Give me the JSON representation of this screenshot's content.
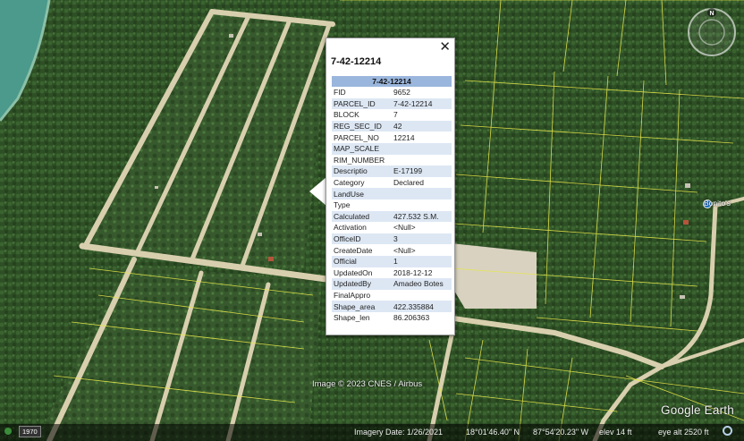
{
  "popup": {
    "title": "7-42-12214",
    "table_header": "7-42-12214",
    "close_symbol": "✕",
    "rows": [
      {
        "key": "FID",
        "value": "9652"
      },
      {
        "key": "PARCEL_ID",
        "value": "7-42-12214"
      },
      {
        "key": "BLOCK",
        "value": "7"
      },
      {
        "key": "REG_SEC_ID",
        "value": "42"
      },
      {
        "key": "PARCEL_NO",
        "value": "12214"
      },
      {
        "key": "MAP_SCALE",
        "value": ""
      },
      {
        "key": "RIM_NUMBER",
        "value": ""
      },
      {
        "key": "Descriptio",
        "value": "E-17199"
      },
      {
        "key": "Category",
        "value": "Declared"
      },
      {
        "key": "LandUse",
        "value": ""
      },
      {
        "key": "Type",
        "value": ""
      },
      {
        "key": "Calculated",
        "value": "427.532 S.M."
      },
      {
        "key": "Activation",
        "value": "<Null>"
      },
      {
        "key": "OfficeID",
        "value": "3"
      },
      {
        "key": "CreateDate",
        "value": "<Null>"
      },
      {
        "key": "Official",
        "value": "1"
      },
      {
        "key": "UpdatedOn",
        "value": "2018-12-12"
      },
      {
        "key": "UpdatedBy",
        "value": "Amadeo Botes"
      },
      {
        "key": "FinalAppro",
        "value": ""
      },
      {
        "key": "Shape_area",
        "value": "422.335884"
      },
      {
        "key": "Shape_len",
        "value": "86.206363"
      }
    ]
  },
  "map": {
    "copyright": "Image © 2023 CNES / Airbus",
    "place_label": "Bonito's",
    "brand": "Google Earth",
    "compass_north": "N",
    "historical_year": "1970"
  },
  "status_bar": {
    "imagery_date": "Imagery Date: 1/26/2021",
    "lat": "18°01'46.40\" N",
    "lon": "87°54'20.23\" W",
    "elev": "elev   14 ft",
    "eye_alt": "eye alt  2520 ft"
  },
  "colors": {
    "parcel_lines": "#e8e84a",
    "road": "#d8cfae",
    "vegetation": "#2f5226",
    "popup_header": "#9ab6dc",
    "popup_row_alt": "#dde7f4"
  }
}
